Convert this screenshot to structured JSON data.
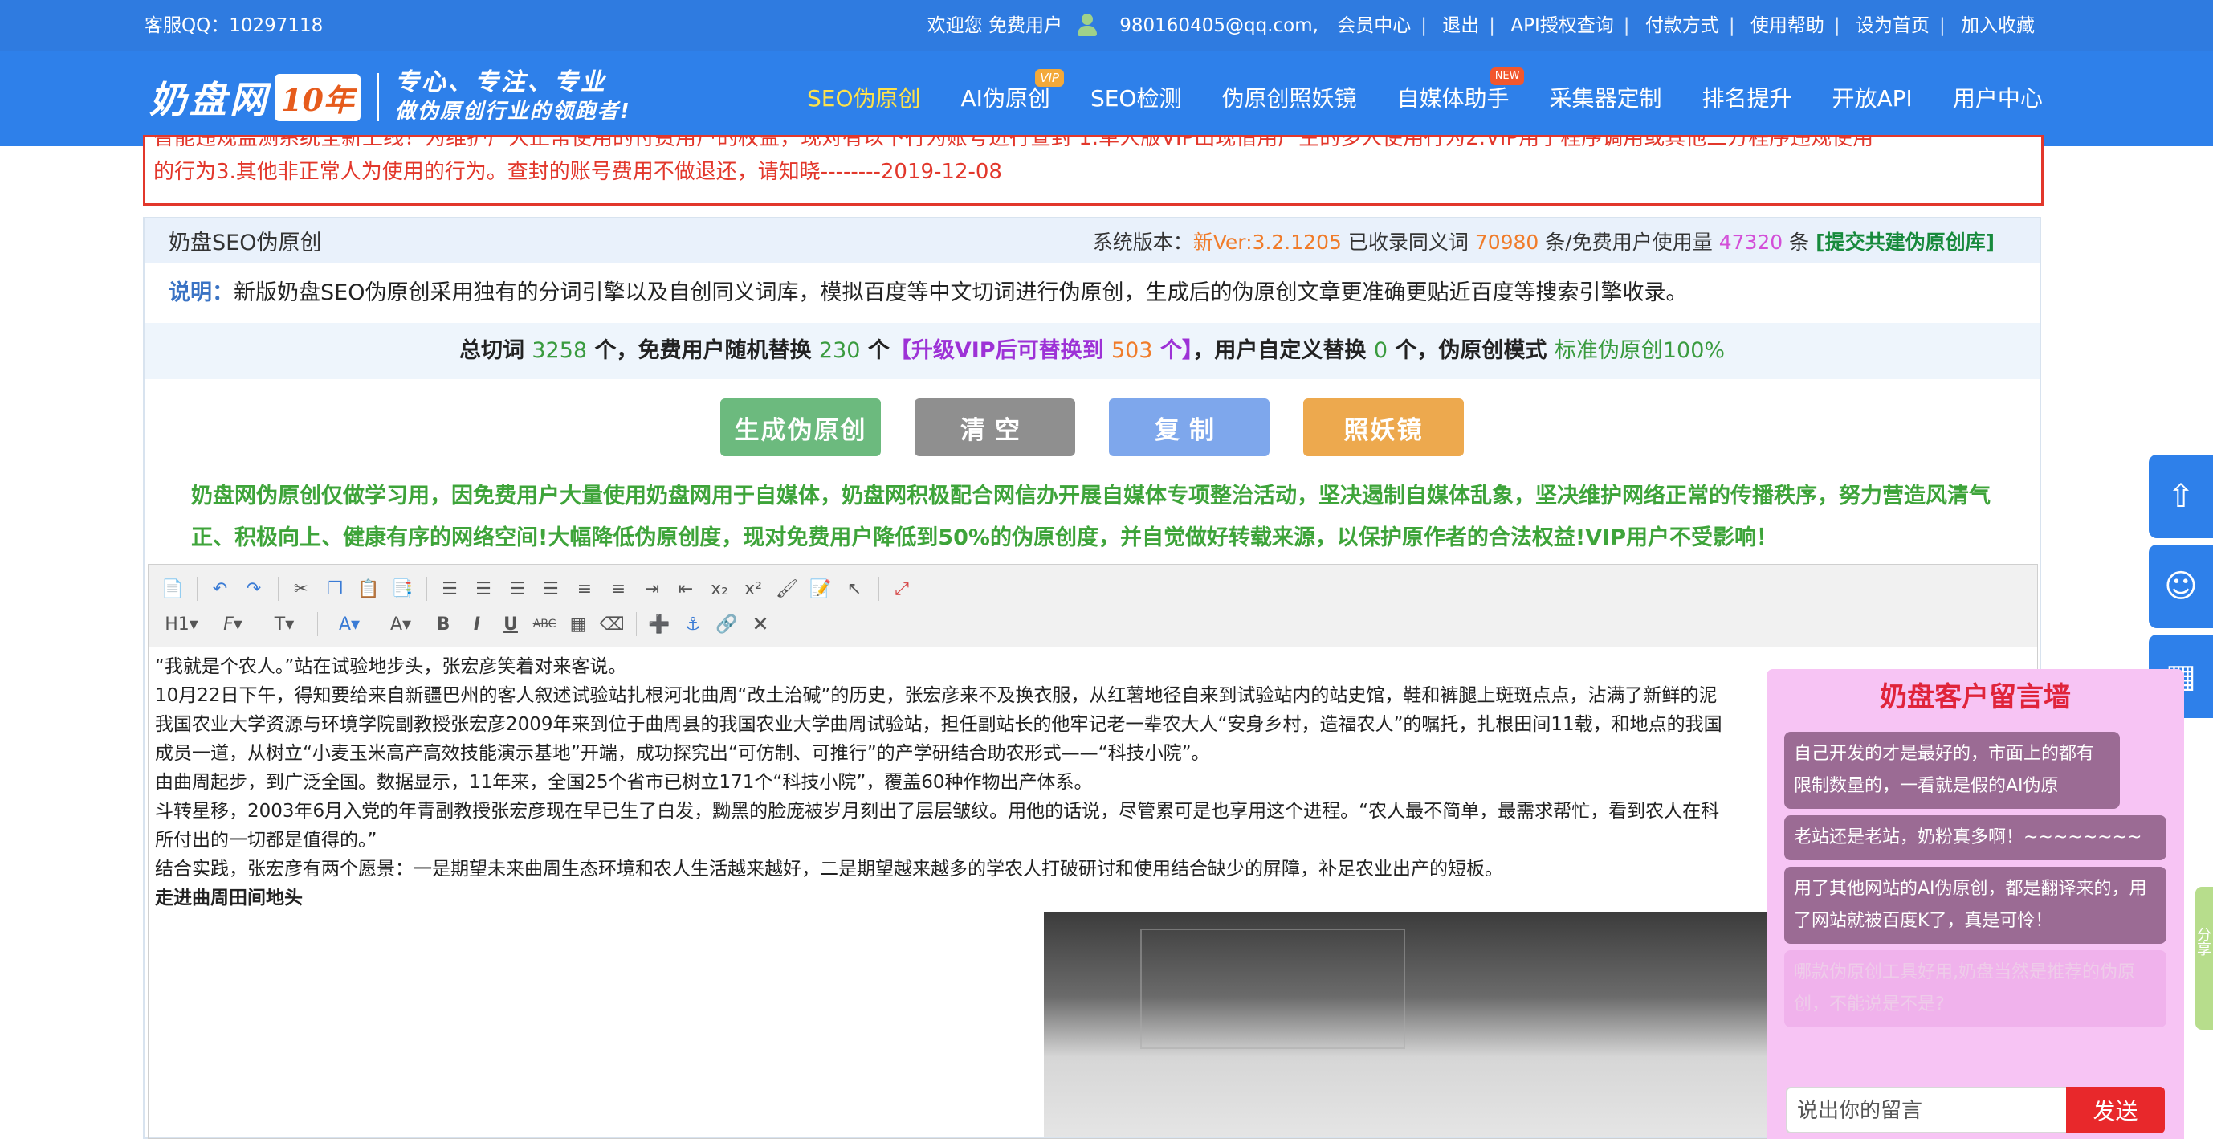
{
  "topbar": {
    "qq": "客服QQ：10297118",
    "welcome": "欢迎您 免费用户",
    "email": "980160405@qq.com,",
    "links": [
      "会员中心",
      "退出",
      "API授权查询",
      "付款方式",
      "使用帮助",
      "设为首页",
      "加入收藏"
    ]
  },
  "logo": {
    "name": "奶盘网",
    "badge": "10年",
    "slogan1": "专心、专注、专业",
    "slogan2": "做伪原创行业的领跑者!"
  },
  "nav": {
    "items": [
      "SEO伪原创",
      "AI伪原创",
      "SEO检测",
      "伪原创照妖镜",
      "自媒体助手",
      "采集器定制",
      "排名提升",
      "开放API",
      "用户中心"
    ],
    "vip_badge": "VIP",
    "new_badge": "NEW"
  },
  "notice": {
    "line1": "智能违规监测系统全新上线！为维护广大正常使用的付费用户的权益，现对有以下行为账号进行查封 1.单人版VIP出现借用产生的多人使用行为2.VIP用于程序调用或其他三方程序违规使用",
    "line2": "的行为3.其他非正常人为使用的行为。查封的账号费用不做退还，请知晓--------2019-12-08"
  },
  "main": {
    "title": "奶盘SEO伪原创",
    "stats": {
      "label": "系统版本：",
      "version": "新Ver:3.2.1205",
      "words_label": "已收录同义词",
      "words": "70980",
      "usage_label": "条/免费用户使用量",
      "usage": "47320",
      "unit": "条",
      "submit": "[提交共建伪原创库]"
    },
    "desc_label": "说明：",
    "desc": "新版奶盘SEO伪原创采用独有的分词引擎以及自创同义词库，模拟百度等中文切词进行伪原创，生成后的伪原创文章更准确更贴近百度等搜索引擎收录。",
    "summary": {
      "p1": "总切词",
      "total": "3258",
      "p2": "个，免费用户随机替换",
      "random": "230",
      "p3": "个",
      "vip": "【升级VIP后可替换到",
      "vip_num": "503",
      "vip_end": "个】",
      "p4": "，用户自定义替换",
      "custom": "0",
      "p5": "个，伪原创模式",
      "mode": "标准伪原创100%"
    },
    "buttons": {
      "generate": "生成伪原创",
      "clear": "清空",
      "copy": "复制",
      "mirror": "照妖镜"
    },
    "green_note": "奶盘网伪原创仅做学习用，因免费用户大量使用奶盘网用于自媒体，奶盘网积极配合网信办开展自媒体专项整治活动，坚决遏制自媒体乱象，坚决维护网络正常的传播秩序，努力营造风清气正、积极向上、健康有序的网络空间!大幅降低伪原创度，现对免费用户降低到50%的伪原创度，并自觉做好转载来源，以保护原作者的合法权益!VIP用户不受影响！"
  },
  "toolbar": {
    "heading_label": "H1",
    "font_family_label": "F",
    "font_size_label": "T"
  },
  "editor": {
    "p1": "“我就是个农人。”站在试验地步头，张宏彦笑着对来客说。",
    "p2": "10月22日下午，得知要给来自新疆巴州的客人叙述试验站扎根河北曲周“改土治碱”的历史，张宏彦来不及换衣服，从红薯地径自来到试验站内的站史馆，鞋和裤腿上斑斑点点，沾满了新鲜的泥",
    "p3": "我国农业大学资源与环境学院副教授张宏彦2009年来到位于曲周县的我国农业大学曲周试验站，担任副站长的他牢记老一辈农大人“安身乡村，造福农人”的嘱托，扎根田间11载，和地点的我国",
    "p4": "成员一道，从树立“小麦玉米高产高效技能演示基地”开端，成功探究出“可仿制、可推行”的产学研结合助农形式——“科技小院”。",
    "p5": "由曲周起步，到广泛全国。数据显示，11年来，全国25个省市已树立171个“科技小院”，覆盖60种作物出产体系。",
    "p6": "斗转星移，2003年6月入党的年青副教授张宏彦现在早已生了白发，黝黑的脸庞被岁月刻出了层层皱纹。用他的话说，尽管累可是也享用这个进程。“农人最不简单，最需求帮忙，看到农人在科",
    "p7": "所付出的一切都是值得的。”",
    "p8": "结合实践，张宏彦有两个愿景：一是期望未来曲周生态环境和农人生活越来越好，二是期望越来越多的学农人打破研讨和使用结合缺少的屏障，补足农业出产的短板。",
    "p9": "走进曲周田间地头"
  },
  "msgwall": {
    "title": "奶盘客户留言墙",
    "messages": [
      "自己开发的才是最好的，市面上的都有限制数量的，一看就是假的AI伪原",
      "老站还是老站，奶粉真多啊！~~~~~~~~",
      "用了其他网站的AI伪原创，都是翻译来的，用了网站就被百度K了，真是可怜！",
      "哪款伪原创工具好用,奶盘当然是推荐的伪原创，不能说是不是?"
    ],
    "placeholder": "说出你的留言",
    "send": "发送"
  },
  "side": {
    "green_tab": "分享"
  },
  "colors": {
    "brand_blue": "#2e80ea",
    "notice_red": "#e2372b",
    "note_green": "#3ea43a"
  }
}
